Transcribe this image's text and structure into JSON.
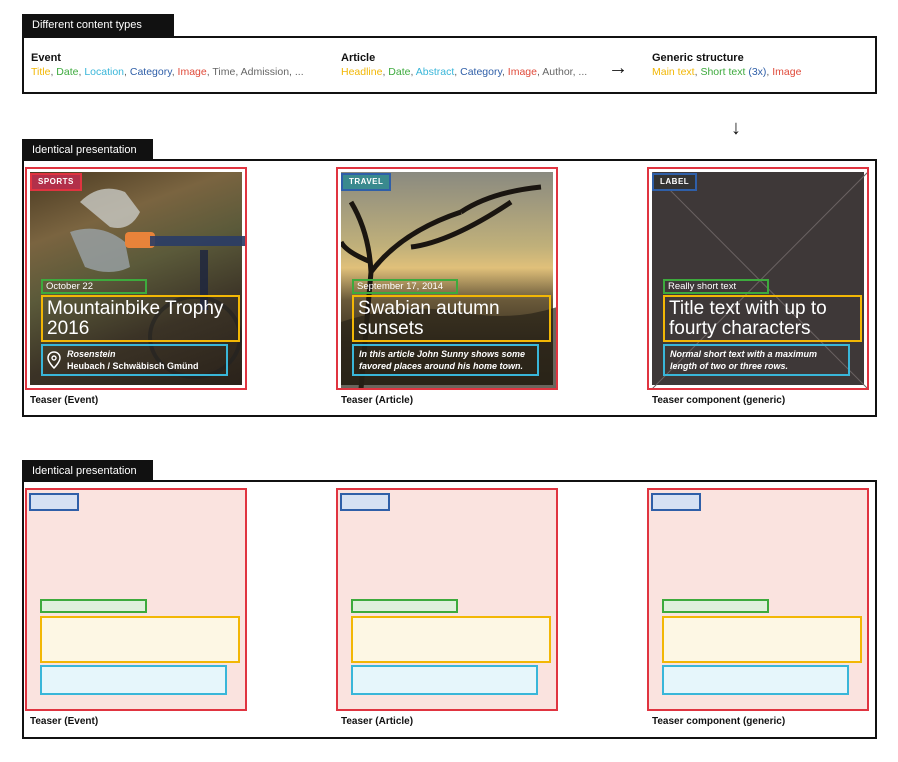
{
  "section1": {
    "tab": "Different content types",
    "event": {
      "heading": "Event",
      "fields": [
        {
          "text": "Title",
          "color": "yellow"
        },
        {
          "text": "Date",
          "color": "green"
        },
        {
          "text": "Location",
          "color": "lightblue"
        },
        {
          "text": "Category",
          "color": "blue"
        },
        {
          "text": "Image",
          "color": "red"
        },
        {
          "text": "Time",
          "color": "gray"
        },
        {
          "text": "Admission, ...",
          "color": "gray"
        }
      ]
    },
    "article": {
      "heading": "Article",
      "fields": [
        {
          "text": "Headline",
          "color": "yellow"
        },
        {
          "text": "Date",
          "color": "green"
        },
        {
          "text": "Abstract",
          "color": "lightblue"
        },
        {
          "text": "Category",
          "color": "blue"
        },
        {
          "text": "Image",
          "color": "red"
        },
        {
          "text": "Author, ...",
          "color": "gray"
        }
      ]
    },
    "generic": {
      "heading": "Generic structure",
      "fields": [
        {
          "text": "Main text",
          "color": "yellow"
        },
        {
          "text": "Short text",
          "color": "green"
        },
        {
          "text": "(3x)",
          "color": "blue"
        },
        {
          "text": "Image",
          "color": "red"
        }
      ]
    },
    "arrow_right": "→",
    "arrow_down": "↓"
  },
  "section2": {
    "tab": "Identical presentation",
    "cards": [
      {
        "label": "SPORTS",
        "date": "October 22",
        "title": "Mountainbike Trophy 2016",
        "meta_line1": "Rosenstein",
        "meta_line2": "Heubach / Schwäbisch Gmünd",
        "caption": "Teaser (Event)"
      },
      {
        "label": "TRAVEL",
        "date": "September 17, 2014",
        "title": "Swabian autumn sunsets",
        "meta_line1": "In this article John Sunny shows some",
        "meta_line2": "favored places around his home town.",
        "caption": "Teaser (Article)"
      },
      {
        "label": "LABEL",
        "date": "Really short text",
        "title": "Title text with up to fourty characters",
        "meta_line1": "Normal short text with a maximum",
        "meta_line2": "length of two or three rows.",
        "caption": "Teaser component (generic)"
      }
    ]
  },
  "section3": {
    "tab": "Identical presentation",
    "captions": [
      "Teaser (Event)",
      "Teaser (Article)",
      "Teaser component (generic)"
    ]
  },
  "colors": {
    "card_border": "#e03440",
    "label_border": "#2f5fa8",
    "date_border": "#3daa3d",
    "title_border": "#f2b705",
    "meta_border": "#39b6d9",
    "sports_label_bg": "#b2304a",
    "travel_label_bg": "#3a8a8e",
    "wireframe_fill": "#fae3df"
  }
}
